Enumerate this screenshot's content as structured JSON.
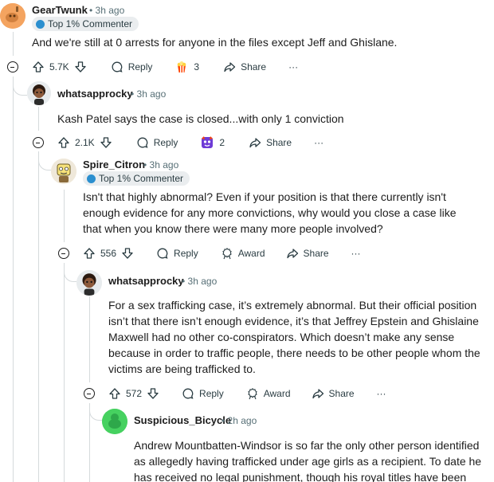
{
  "comments": [
    {
      "username": "GearTwunk",
      "time": "• 3h ago",
      "badge": "Top 1% Commenter",
      "text": "And we're still at 0 arrests for anyone in the files except Jeff and Ghislane.",
      "votes": "5.7K",
      "reply_label": "Reply",
      "award_count": "3",
      "share_label": "Share",
      "more_label": "···"
    },
    {
      "username": "whatsapprocky",
      "time": "• 3h ago",
      "text": "Kash Patel says the case is closed...with only 1 conviction",
      "votes": "2.1K",
      "reply_label": "Reply",
      "award_count": "2",
      "share_label": "Share",
      "more_label": "···"
    },
    {
      "username": "Spire_Citron",
      "time": "• 3h ago",
      "badge": "Top 1% Commenter",
      "text": "Isn't that highly abnormal? Even if your position is that there currently isn't enough evidence for any more convictions, why would you close a case like that when you know there were many more people involved?",
      "votes": "556",
      "reply_label": "Reply",
      "award_label": "Award",
      "share_label": "Share",
      "more_label": "···"
    },
    {
      "username": "whatsapprocky",
      "time": "• 3h ago",
      "text": "For a sex trafficking case, it’s extremely abnormal. But their official position isn’t that there isn’t enough evidence, it’s that Jeffrey Epstein and Ghislaine Maxwell had no other co-conspirators. Which doesn’t make any sense because in order to traffic people, there needs to be other people whom the victims are being trafficked to.",
      "votes": "572",
      "reply_label": "Reply",
      "award_label": "Award",
      "share_label": "Share",
      "more_label": "···"
    },
    {
      "username": "Suspicious_Bicycle",
      "time": "• 2h ago",
      "text": "Andrew Mountbatten-Windsor is so far the only other person identified as allegedly having trafficked under age girls as a recipient. To date he has received no legal punishment, though his royal titles have been"
    }
  ],
  "colors": {
    "accent_orange": "#f4a460",
    "avatar_green": "#46d160",
    "thread_line": "#d5dadc",
    "award_red": "#ff4500",
    "award_purple": "#6e3bd6"
  },
  "icons": [
    "upvote-icon",
    "downvote-icon",
    "comment-icon",
    "share-icon",
    "award-icon",
    "more-icon",
    "collapse-icon"
  ]
}
